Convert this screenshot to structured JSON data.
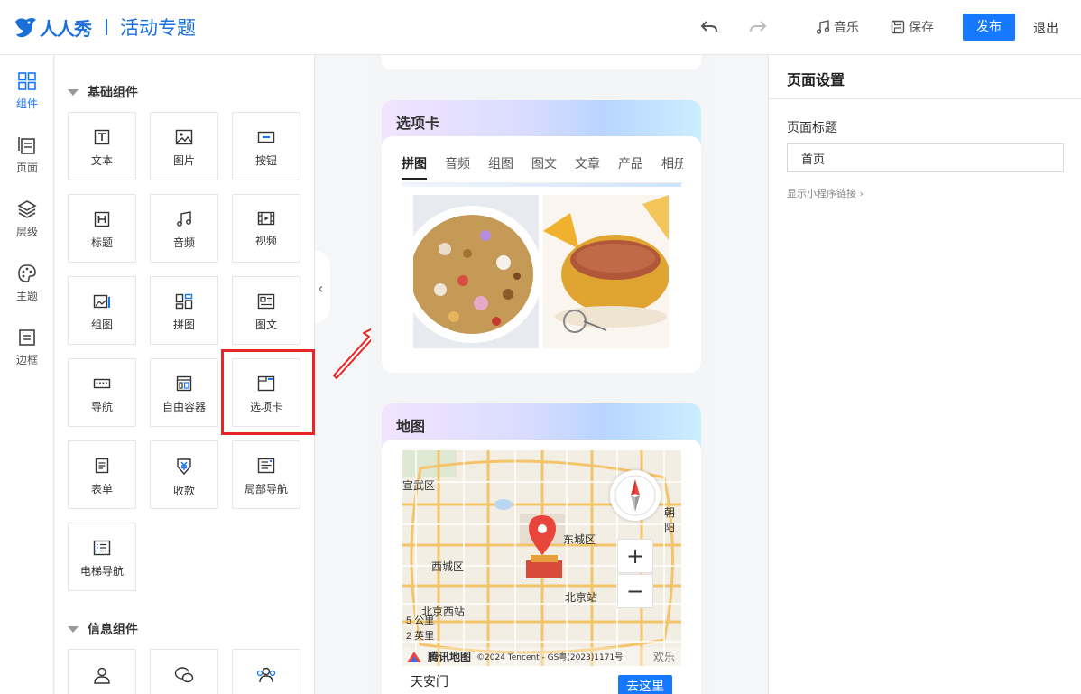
{
  "header": {
    "logo_text": "人人秀",
    "subtitle": "活动专题",
    "music_label": "音乐",
    "save_label": "保存",
    "publish_label": "发布",
    "exit_label": "退出"
  },
  "rail": [
    {
      "label": "组件",
      "active": true
    },
    {
      "label": "页面"
    },
    {
      "label": "层级"
    },
    {
      "label": "主题"
    },
    {
      "label": "边框"
    }
  ],
  "panel": {
    "basic_title": "基础组件",
    "basic": [
      "文本",
      "图片",
      "按钮",
      "标题",
      "音频",
      "视频",
      "组图",
      "拼图",
      "图文",
      "导航",
      "自由容器",
      "选项卡",
      "表单",
      "收款",
      "局部导航",
      "电梯导航"
    ],
    "info_title": "信息组件"
  },
  "preview": {
    "tabs_block": {
      "title": "选项卡",
      "tabs": [
        "拼图",
        "音频",
        "组图",
        "图文",
        "文章",
        "产品",
        "相册"
      ]
    },
    "map_block": {
      "title": "地图",
      "labels": {
        "xicheng": "西城区",
        "dongcheng": "东城区",
        "xuanzhi": "宣武区",
        "beijing_west": "北京西站",
        "beijing_station": "北京站",
        "chaoyang": "朝阳",
        "huanle": "欢乐谷",
        "scale_km": "5 公里",
        "scale_mi": "2 英里"
      },
      "footer_brand": "腾讯地图",
      "footer_copy": "©2024 Tencent - GS粤(2023)1171号",
      "place": "天安门",
      "goto_label": "去这里"
    }
  },
  "settings": {
    "title": "页面设置",
    "field_label": "页面标题",
    "field_value": "首页",
    "mini_link": "显示小程序链接 ›"
  },
  "colors": {
    "accent": "#1677ff",
    "brand": "#1a6fd8",
    "highlight": "#e82424"
  }
}
